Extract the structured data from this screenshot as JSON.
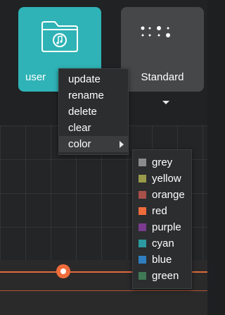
{
  "presets": {
    "user": {
      "label": "user",
      "icon": "folder-music-icon",
      "color": "#2fb3b6"
    },
    "standard": {
      "label": "Standard",
      "icon": "dots-pattern-icon",
      "color": "#454748"
    }
  },
  "context_menu": {
    "items": [
      {
        "label": "update"
      },
      {
        "label": "rename"
      },
      {
        "label": "delete"
      },
      {
        "label": "clear"
      },
      {
        "label": "color",
        "has_submenu": true
      }
    ]
  },
  "color_submenu": {
    "items": [
      {
        "label": "grey",
        "color": "#8c8c8c"
      },
      {
        "label": "yellow",
        "color": "#9a9a4a"
      },
      {
        "label": "orange",
        "color": "#a8504a"
      },
      {
        "label": "red",
        "color": "#ee6b3b"
      },
      {
        "label": "purple",
        "color": "#7a3b8e"
      },
      {
        "label": "cyan",
        "color": "#2c9aa0"
      },
      {
        "label": "blue",
        "color": "#2f7fc0"
      },
      {
        "label": "green",
        "color": "#3f7a55"
      }
    ]
  },
  "accent_color": "#ef6c3c"
}
